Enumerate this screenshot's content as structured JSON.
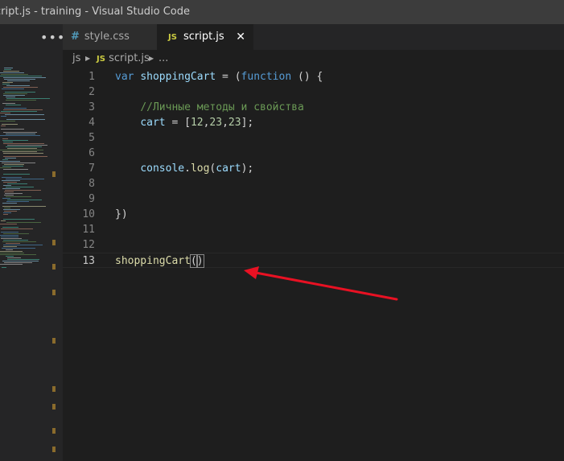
{
  "window": {
    "title": "cript.js - training - Visual Studio Code"
  },
  "explorer": {
    "more_label": "•••"
  },
  "tabs": [
    {
      "icon": "#",
      "label": "style.css"
    },
    {
      "icon": "JS",
      "label": "script.js",
      "close": "✕"
    }
  ],
  "breadcrumb": {
    "folder": "js",
    "file_icon": "JS",
    "file": "script.js",
    "more": "..."
  },
  "editor": {
    "current_line": 13,
    "lines": [
      {
        "num": "1",
        "tokens": [
          [
            "kw",
            "var"
          ],
          [
            "plain",
            " "
          ],
          [
            "var",
            "shoppingCart"
          ],
          [
            "plain",
            " = ("
          ],
          [
            "kw",
            "function"
          ],
          [
            "plain",
            " () {"
          ]
        ]
      },
      {
        "num": "2",
        "tokens": []
      },
      {
        "num": "3",
        "tokens": [
          [
            "plain",
            "    "
          ],
          [
            "cmt",
            "//Личные методы и свойства"
          ]
        ]
      },
      {
        "num": "4",
        "tokens": [
          [
            "plain",
            "    "
          ],
          [
            "var",
            "cart"
          ],
          [
            "plain",
            " = ["
          ],
          [
            "num",
            "12"
          ],
          [
            "plain",
            ","
          ],
          [
            "num",
            "23"
          ],
          [
            "plain",
            ","
          ],
          [
            "num",
            "23"
          ],
          [
            "plain",
            "];"
          ]
        ]
      },
      {
        "num": "5",
        "tokens": []
      },
      {
        "num": "6",
        "tokens": []
      },
      {
        "num": "7",
        "tokens": [
          [
            "plain",
            "    "
          ],
          [
            "var",
            "console"
          ],
          [
            "plain",
            "."
          ],
          [
            "fn",
            "log"
          ],
          [
            "plain",
            "("
          ],
          [
            "var",
            "cart"
          ],
          [
            "plain",
            ");"
          ]
        ]
      },
      {
        "num": "8",
        "tokens": []
      },
      {
        "num": "9",
        "tokens": []
      },
      {
        "num": "10",
        "tokens": [
          [
            "plain",
            "})"
          ]
        ]
      },
      {
        "num": "11",
        "tokens": []
      },
      {
        "num": "12",
        "tokens": []
      },
      {
        "num": "13",
        "tokens": [
          [
            "fn",
            "shoppingCart"
          ],
          [
            "bracket",
            "("
          ],
          [
            "bracket",
            ")"
          ]
        ]
      }
    ]
  },
  "annotation": {
    "arrow_color": "#e81123"
  }
}
